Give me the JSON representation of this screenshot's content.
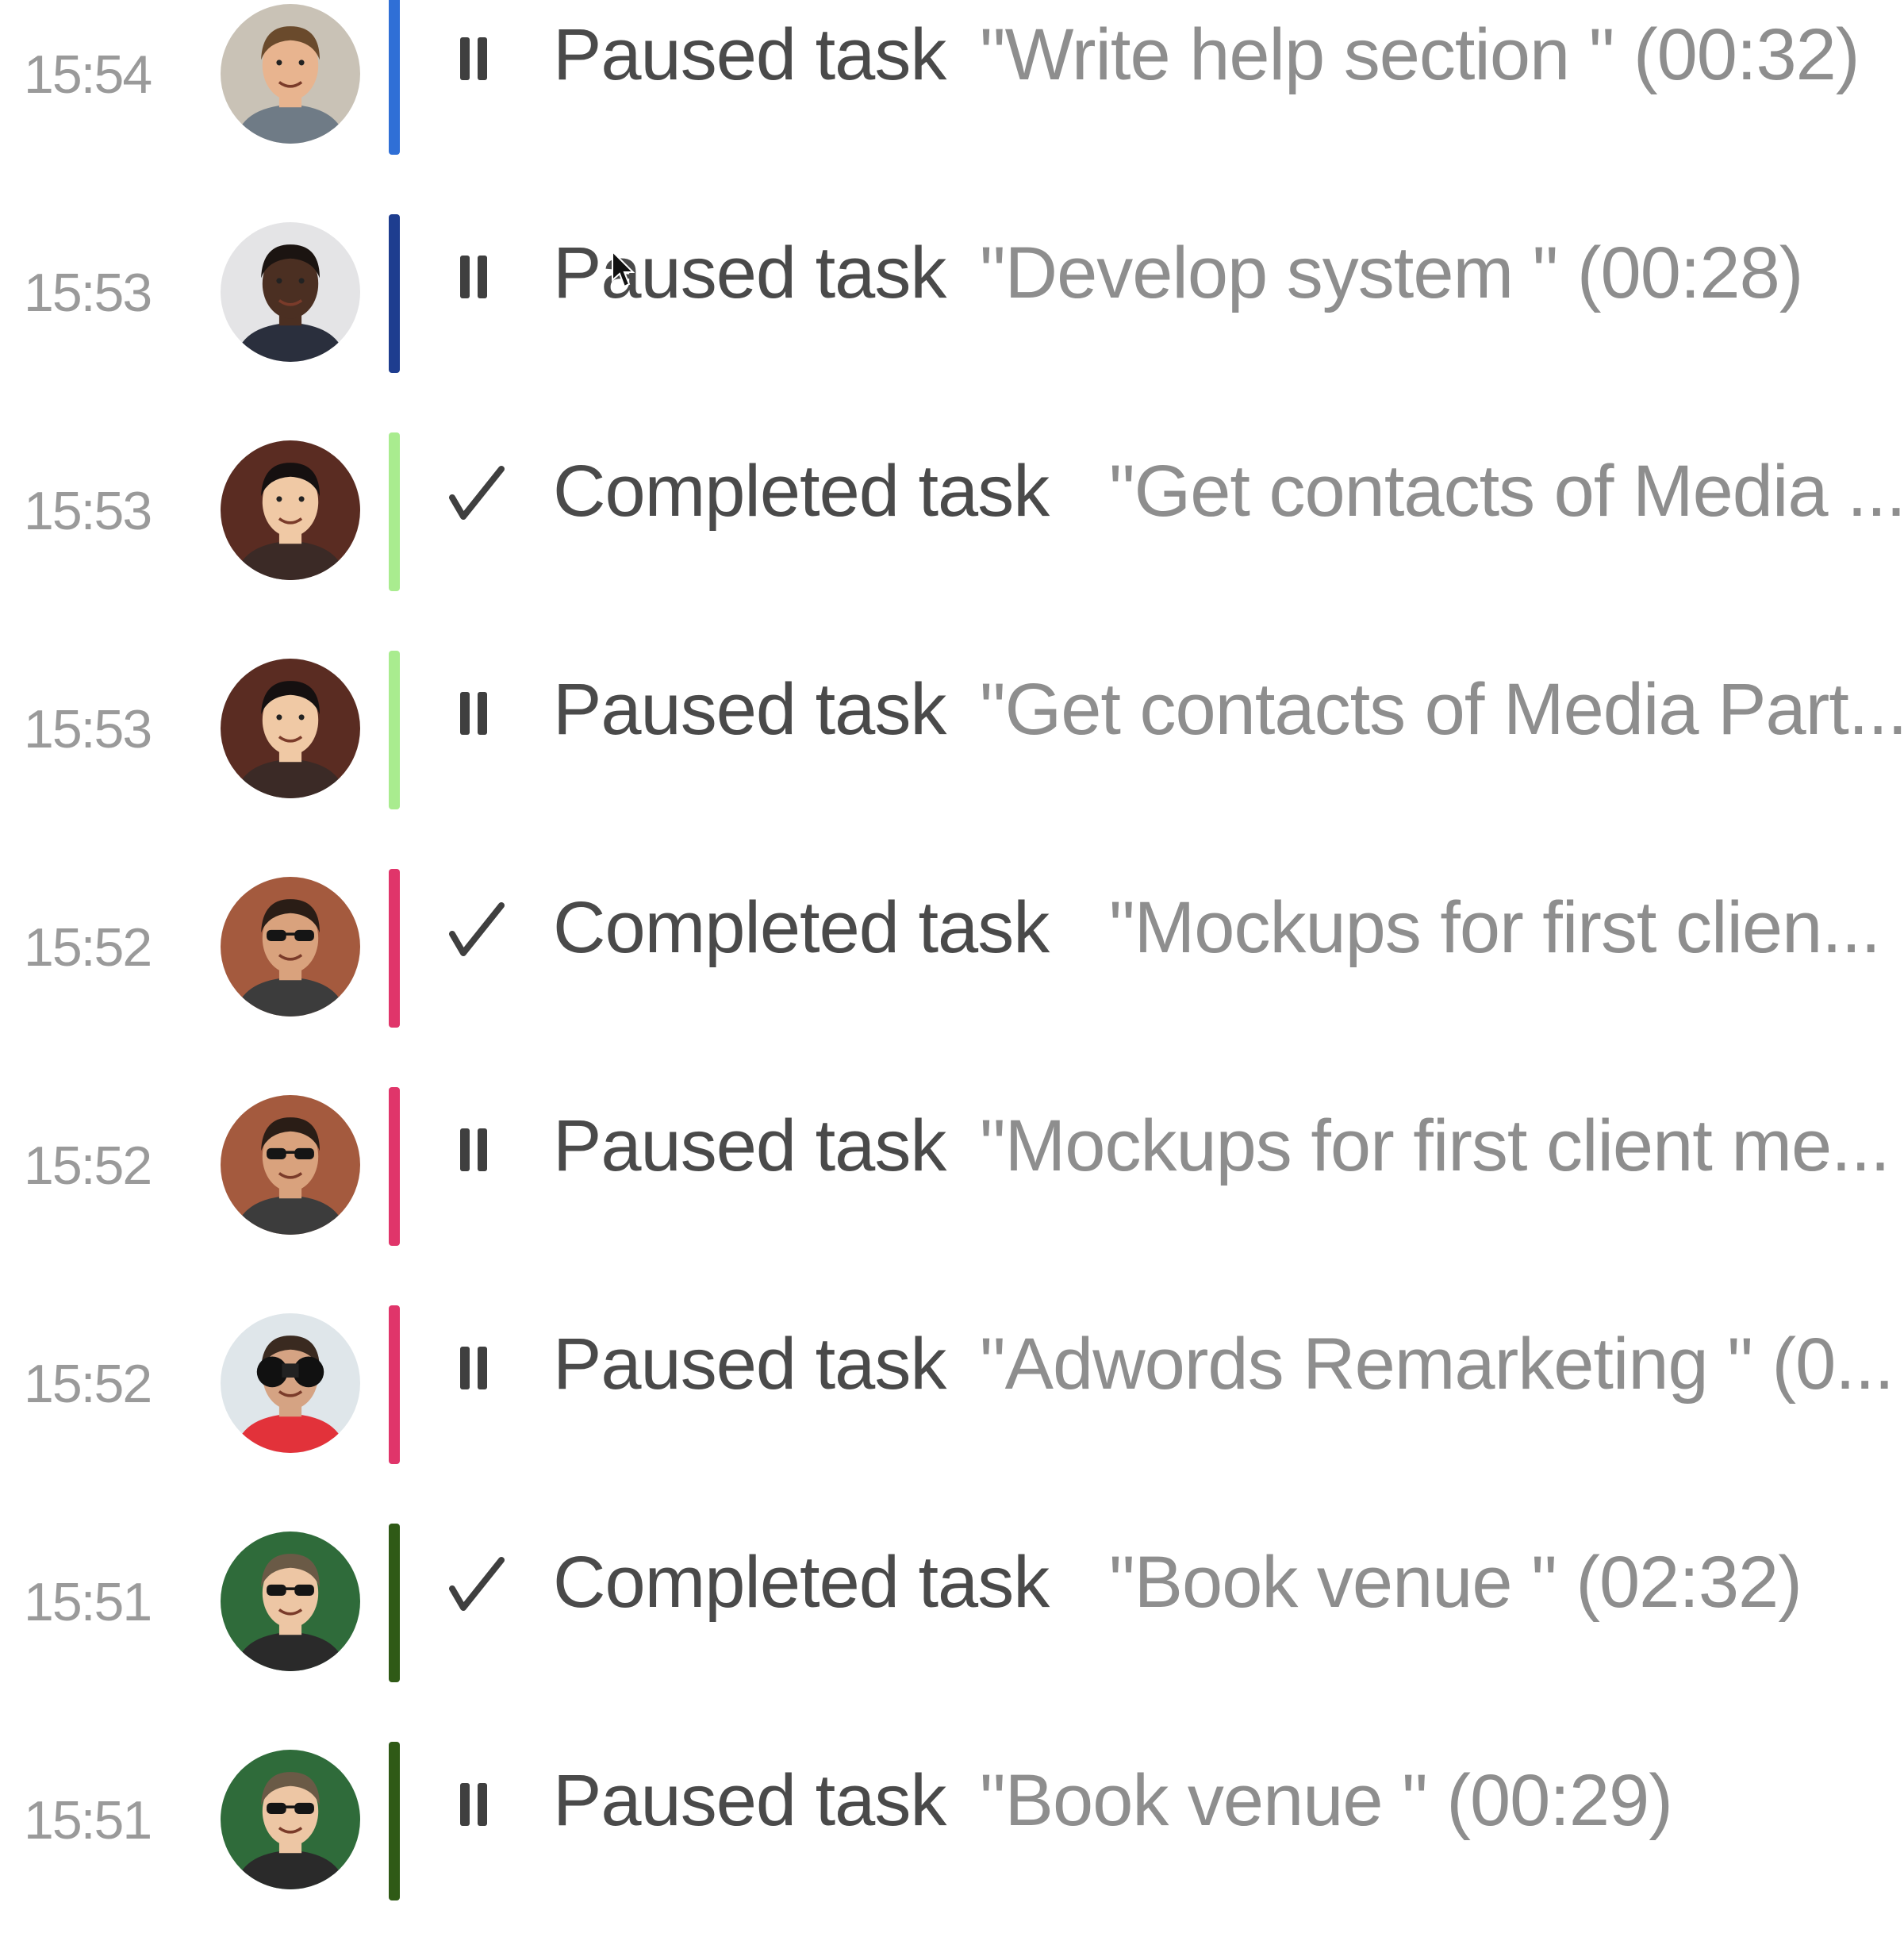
{
  "feed": {
    "items": [
      {
        "time": "15:54",
        "action": "Paused task",
        "detail": "\"Write help section \" (00:32)",
        "status": "paused",
        "bar_color": "#2f6fd6",
        "avatar": {
          "bg": "#c9c2b6",
          "skin": "#e8b48f",
          "hair": "#6a4a2c",
          "shirt": "#6f7b86",
          "glasses": false,
          "binoculars": false
        }
      },
      {
        "time": "15:53",
        "action": "Paused task",
        "detail": "\"Develop system \" (00:28)",
        "status": "paused",
        "bar_color": "#1e3d8f",
        "avatar": {
          "bg": "#e4e4e6",
          "skin": "#4b2f22",
          "hair": "#1b1411",
          "shirt": "#2a2f3d",
          "glasses": false,
          "binoculars": false
        }
      },
      {
        "time": "15:53",
        "action": "Completed task",
        "detail": "\"Get contacts of Media ...",
        "status": "completed",
        "bar_color": "#a9ec8f",
        "avatar": {
          "bg": "#5a2c22",
          "skin": "#f0c9a5",
          "hair": "#151010",
          "shirt": "#3b2a26",
          "glasses": false,
          "binoculars": false
        }
      },
      {
        "time": "15:53",
        "action": "Paused task",
        "detail": "\"Get contacts of Media Part...",
        "status": "paused",
        "bar_color": "#a9ec8f",
        "avatar": {
          "bg": "#5a2c22",
          "skin": "#f0c9a5",
          "hair": "#151010",
          "shirt": "#3b2a26",
          "glasses": false,
          "binoculars": false
        }
      },
      {
        "time": "15:52",
        "action": "Completed task",
        "detail": "\"Mockups for first clien...",
        "status": "completed",
        "bar_color": "#e0356a",
        "avatar": {
          "bg": "#a45a3e",
          "skin": "#d9a27d",
          "hair": "#2a1d16",
          "shirt": "#3c3c3c",
          "glasses": true,
          "binoculars": false
        }
      },
      {
        "time": "15:52",
        "action": "Paused task",
        "detail": "\"Mockups for first client me...",
        "status": "paused",
        "bar_color": "#e0356a",
        "avatar": {
          "bg": "#a45a3e",
          "skin": "#d9a27d",
          "hair": "#2a1d16",
          "shirt": "#3c3c3c",
          "glasses": true,
          "binoculars": false
        }
      },
      {
        "time": "15:52",
        "action": "Paused task",
        "detail": "\"Adwords Remarketing \" (0...",
        "status": "paused",
        "bar_color": "#e0356a",
        "avatar": {
          "bg": "#dfe6ea",
          "skin": "#d5a383",
          "hair": "#3a2a20",
          "shirt": "#e2323a",
          "glasses": false,
          "binoculars": true
        }
      },
      {
        "time": "15:51",
        "action": "Completed task",
        "detail": "\"Book venue \" (02:32)",
        "status": "completed",
        "bar_color": "#2f5a16",
        "avatar": {
          "bg": "#2f6b3a",
          "skin": "#edc6a4",
          "hair": "#6a5a46",
          "shirt": "#2a2a2a",
          "glasses": true,
          "binoculars": false
        }
      },
      {
        "time": "15:51",
        "action": "Paused task",
        "detail": "\"Book venue \" (00:29)",
        "status": "paused",
        "bar_color": "#2f5a16",
        "avatar": {
          "bg": "#2f6b3a",
          "skin": "#edc6a4",
          "hair": "#6a5a46",
          "shirt": "#2a2a2a",
          "glasses": true,
          "binoculars": false
        }
      }
    ]
  },
  "icons": {
    "paused": "pause-icon",
    "completed": "check-icon"
  },
  "colors": {
    "time_text": "#9a9a9a",
    "action_text": "#4a4a4a",
    "detail_text": "#8e8e8e"
  }
}
